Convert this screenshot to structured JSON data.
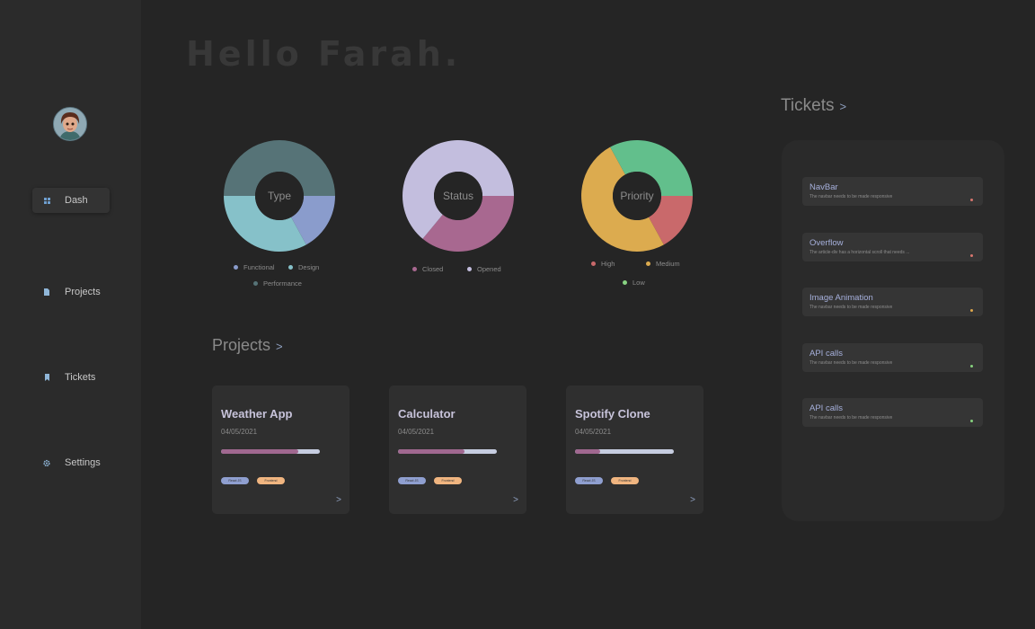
{
  "greeting": "Hello Farah.",
  "sidebar": {
    "items": [
      {
        "label": "Dash",
        "icon": "grid-icon",
        "active": true
      },
      {
        "label": "Projects",
        "icon": "document-icon",
        "active": false
      },
      {
        "label": "Tickets",
        "icon": "bookmark-icon",
        "active": false
      },
      {
        "label": "Settings",
        "icon": "gear-icon",
        "active": false
      }
    ]
  },
  "charts": {
    "type": {
      "center_label": "Type",
      "legend": [
        {
          "label": "Functional",
          "color": "#8a9ccc"
        },
        {
          "label": "Design",
          "color": "#86c1c9"
        },
        {
          "label": "Performance",
          "color": "#567377"
        }
      ]
    },
    "status": {
      "center_label": "Status",
      "legend": [
        {
          "label": "Closed",
          "color": "#a86890"
        },
        {
          "label": "Opened",
          "color": "#c3bede"
        }
      ]
    },
    "priority": {
      "center_label": "Priority",
      "legend": [
        {
          "label": "High",
          "color": "#c9696b"
        },
        {
          "label": "Medium",
          "color": "#dcab4f"
        },
        {
          "label": "Low",
          "color": "#88d382"
        }
      ]
    }
  },
  "chart_data": [
    {
      "type": "pie",
      "center_label": "Type",
      "labels": [
        "Functional",
        "Design",
        "Performance"
      ],
      "values": [
        17,
        33,
        50
      ],
      "colors": [
        "#8a9ccc",
        "#86c1c9",
        "#567377"
      ]
    },
    {
      "type": "pie",
      "center_label": "Status",
      "labels": [
        "Closed",
        "Opened"
      ],
      "values": [
        36,
        64
      ],
      "colors": [
        "#a86890",
        "#c3bede"
      ]
    },
    {
      "type": "pie",
      "center_label": "Priority",
      "labels": [
        "High",
        "Medium",
        "Low"
      ],
      "values": [
        17,
        50,
        33
      ],
      "colors": [
        "#c9696b",
        "#dcab4f",
        "#62bf8c"
      ]
    }
  ],
  "projects": {
    "title": "Projects",
    "chevron": ">",
    "items": [
      {
        "name": "Weather App",
        "date": "04/05/2021",
        "progress": 0.78,
        "tags": [
          "React JS",
          "Frontend"
        ]
      },
      {
        "name": "Calculator",
        "date": "04/05/2021",
        "progress": 0.67,
        "tags": [
          "React JS",
          "Frontend"
        ]
      },
      {
        "name": "Spotify Clone",
        "date": "04/05/2021",
        "progress": 0.25,
        "tags": [
          "React JS",
          "Frontend"
        ]
      }
    ],
    "arrow": ">"
  },
  "tickets": {
    "title": "Tickets",
    "chevron": ">",
    "items": [
      {
        "title": "NavBar",
        "description": "The navbar needs to be made responsive",
        "priority_color": "#d9766e"
      },
      {
        "title": "Overflow",
        "description": "The article-div has a horizontal scroll that needs ...",
        "priority_color": "#d9766e"
      },
      {
        "title": "Image Animation",
        "description": "The navbar needs to be made responsive",
        "priority_color": "#e0a84c"
      },
      {
        "title": "API calls",
        "description": "The navbar needs to be made responsive",
        "priority_color": "#86d27e"
      },
      {
        "title": "API calls",
        "description": "The navbar needs to be made responsive",
        "priority_color": "#86d27e"
      }
    ]
  }
}
